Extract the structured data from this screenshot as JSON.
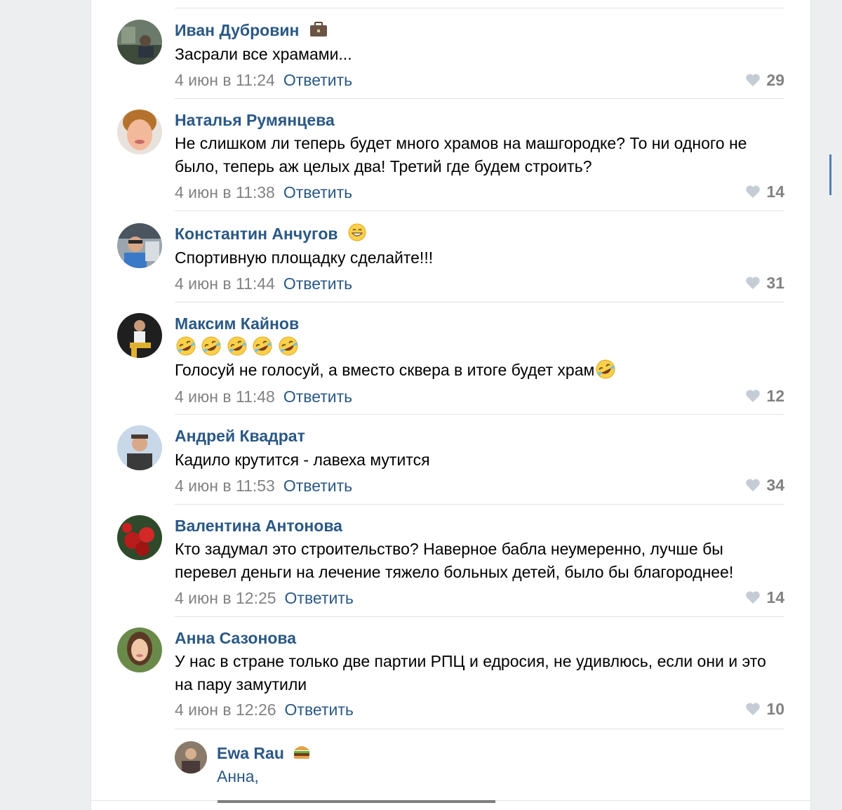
{
  "colors": {
    "name": "#2a5885",
    "date": "#828282",
    "reply": "#2a5885",
    "like": "#828282",
    "separator": "#dfe2e8",
    "accent": "#5181b8"
  },
  "comments": [
    {
      "author": "Иван Дубровин",
      "badge": "briefcase-icon",
      "text": "Засрали все храмами...",
      "date": "4 июн в 11:24",
      "reply_label": "Ответить",
      "likes": "29"
    },
    {
      "author": "Наталья Румянцева",
      "text": "Не слишком ли теперь будет много храмов на машгородке? То ни одного не было, теперь аж целых два! Третий где будем строить?",
      "date": "4 июн в 11:38",
      "reply_label": "Ответить",
      "likes": "14"
    },
    {
      "author": "Константин Анчугов",
      "badge": "grin-emoji-icon",
      "text": "Спортивную площадку сделайте!!!",
      "date": "4 июн в 11:44",
      "reply_label": "Ответить",
      "likes": "31"
    },
    {
      "author": "Максим Кайнов",
      "emoji_line": "rofl-emoji-icon x5",
      "text": "Голосуй не голосуй, а вместо сквера в итоге будет храм",
      "date": "4 июн в 11:48",
      "reply_label": "Ответить",
      "likes": "12"
    },
    {
      "author": "Андрей Квадрат",
      "text": "Кадило крутится - лавеха мутится",
      "date": "4 июн в 11:53",
      "reply_label": "Ответить",
      "likes": "34"
    },
    {
      "author": "Валентина Антонова",
      "text": "Кто задумал это строительство? Наверное бабла неумеренно, лучше бы перевел деньги на лечение тяжело больных детей, было бы благороднее!",
      "date": "4 июн в 12:25",
      "reply_label": "Ответить",
      "likes": "14"
    },
    {
      "author": "Анна Сазонова",
      "text": "У нас в стране только две партии РПЦ и едросия, не удивлюсь, если они и это на пару замутили",
      "date": "4 июн в 12:26",
      "reply_label": "Ответить",
      "likes": "10"
    }
  ],
  "reply_preview": {
    "author": "Ewa Rau",
    "badge": "burger-emoji-icon",
    "text": "Анна,"
  }
}
